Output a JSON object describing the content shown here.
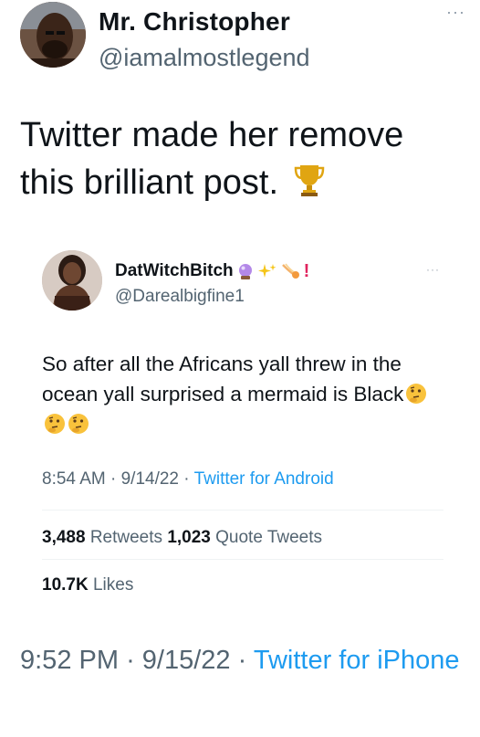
{
  "outer_tweet": {
    "author_name": "Mr. Christopher",
    "author_handle": "@iamalmostlegend",
    "more_label": "···",
    "text": "Twitter made her remove this brilliant post.",
    "emoji_icon": "trophy-icon",
    "time": "9:52 PM",
    "date": "9/15/22",
    "source": "Twitter for iPhone"
  },
  "quoted_tweet": {
    "author_name": "DatWitchBitch",
    "name_emojis": [
      "crystal-ball-icon",
      "sparkles-icon",
      "comet-icon",
      "exclamation-icon"
    ],
    "exclamation": "!",
    "author_handle": "@Darealbigfine1",
    "more_label": "···",
    "text": "So after all the Africans yall threw in the ocean yall surprised a mermaid is Black",
    "trailing_emojis": [
      "thinking-face-icon",
      "thinking-face-icon",
      "thinking-face-icon"
    ],
    "time": "8:54 AM",
    "date": "9/14/22",
    "source": "Twitter for Android",
    "retweets_count": "3,488",
    "retweets_label": "Retweets",
    "quotes_count": "1,023",
    "quotes_label": "Quote Tweets",
    "likes_count": "10.7K",
    "likes_label": "Likes"
  },
  "colors": {
    "text_primary": "#0f1419",
    "text_secondary": "#536471",
    "link_blue": "#1d9bf0",
    "divider": "#eff3f4"
  },
  "separator": "·"
}
